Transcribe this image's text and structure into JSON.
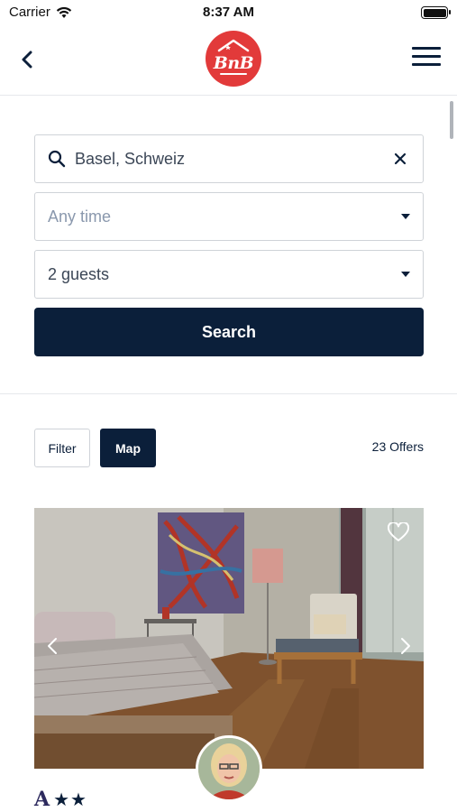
{
  "status_bar": {
    "carrier": "Carrier",
    "time": "8:37 AM"
  },
  "nav": {
    "logo_text": "BnB",
    "brand_color": "#e23a3a"
  },
  "search": {
    "destination_value": "Basel, Schweiz",
    "dates_placeholder": "Any time",
    "guests_value": "2 guests",
    "search_label": "Search"
  },
  "results": {
    "filter_label": "Filter",
    "map_label": "Map",
    "offers_count": "23 Offers"
  },
  "listing": {
    "category_badge": "A",
    "stars": "★★",
    "star_rating": 2
  },
  "colors": {
    "primary": "#0b1f3a",
    "border": "#cfd3d8",
    "placeholder": "#8a98ad"
  }
}
